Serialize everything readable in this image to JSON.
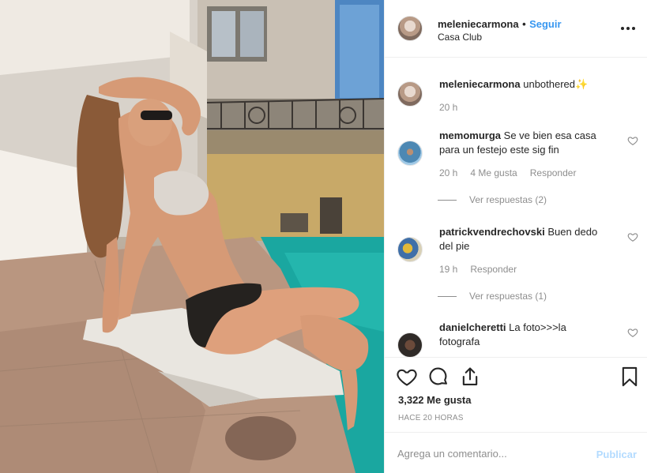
{
  "post": {
    "username": "meleniecarmona",
    "separator": "•",
    "follow_label": "Seguir",
    "location": "Casa Club"
  },
  "comments": [
    {
      "username": "meleniecarmona",
      "text": "unbothered✨",
      "time": "20 h"
    },
    {
      "username": "memomurga",
      "text": "Se ve bien esa casa para un festejo este sig fin",
      "time": "20 h",
      "likes": "4 Me gusta",
      "reply_label": "Responder",
      "view_replies": "Ver respuestas (2)"
    },
    {
      "username": "patrickvendrechovski",
      "text": "Buen dedo del pie",
      "time": "19 h",
      "reply_label": "Responder",
      "view_replies": "Ver respuestas (1)"
    },
    {
      "username": "danielcheretti",
      "text": "La foto>>>la fotografa"
    }
  ],
  "actions": {
    "like_count": "3,322 Me gusta",
    "timestamp": "HACE 20 HORAS"
  },
  "add_comment": {
    "placeholder": "Agrega un comentario...",
    "publish_label": "Publicar"
  },
  "colors": {
    "link_blue": "#3897f0",
    "publish_disabled": "#b3dbff",
    "muted_text": "#8e8e8e",
    "pool_water": "#1aa7a0"
  },
  "icons": [
    "more-options-icon",
    "heart-icon",
    "comment-icon",
    "share-icon",
    "bookmark-icon"
  ]
}
